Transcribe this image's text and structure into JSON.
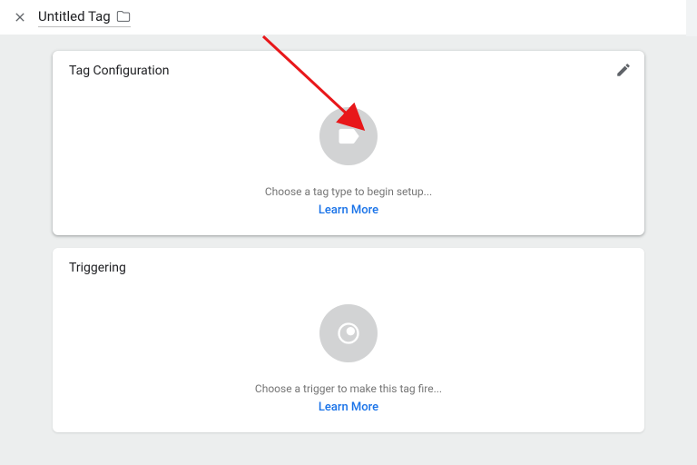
{
  "header": {
    "title": "Untitled Tag"
  },
  "cards": {
    "config": {
      "title": "Tag Configuration",
      "hint": "Choose a tag type to begin setup...",
      "learn": "Learn More"
    },
    "trigger": {
      "title": "Triggering",
      "hint": "Choose a trigger to make this tag fire...",
      "learn": "Learn More"
    }
  }
}
